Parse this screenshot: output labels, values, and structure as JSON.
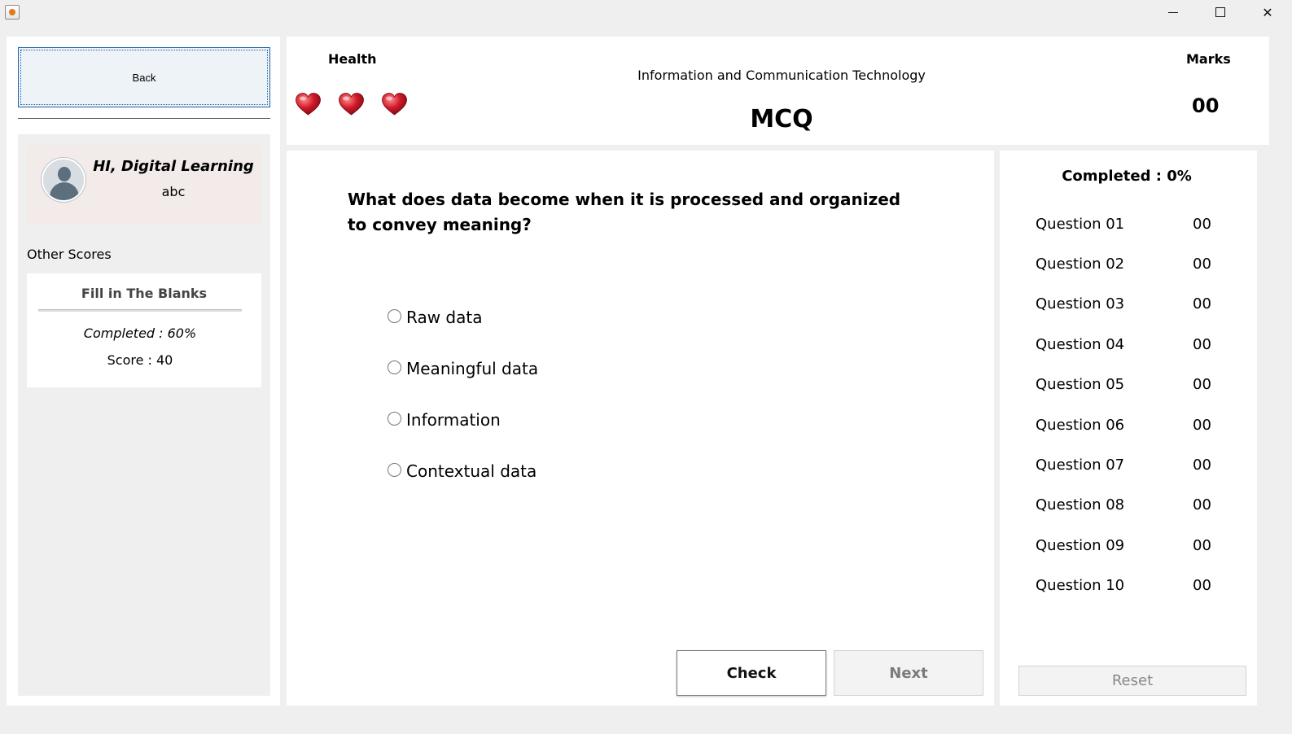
{
  "window": {
    "minimize_glyph": "",
    "maximize_glyph": "",
    "close_glyph": "✕"
  },
  "sidebar": {
    "back_label": "Back",
    "profile": {
      "greeting": "HI, Digital Learning",
      "username": "abc"
    },
    "other_scores_label": "Other Scores",
    "score_card": {
      "title": "Fill in The Blanks",
      "completed": "Completed : 60%",
      "score": "Score : 40"
    }
  },
  "header": {
    "health_label": "Health",
    "hearts_count": 3,
    "subject": "Information and Communication Technology",
    "mode": "MCQ",
    "marks_label": "Marks",
    "marks_value": "00",
    "heart_color": "#c8102e"
  },
  "question": {
    "text": "What does data become when it is processed and organized to convey meaning?",
    "options": [
      "Raw data",
      "Meaningful data",
      "Information",
      "Contextual data"
    ],
    "check_label": "Check",
    "next_label": "Next"
  },
  "progress": {
    "completed_title": "Completed : 0%",
    "rows": [
      {
        "name": "Question 01",
        "score": "00"
      },
      {
        "name": "Question 02",
        "score": "00"
      },
      {
        "name": "Question 03",
        "score": "00"
      },
      {
        "name": "Question 04",
        "score": "00"
      },
      {
        "name": "Question 05",
        "score": "00"
      },
      {
        "name": "Question 06",
        "score": "00"
      },
      {
        "name": "Question 07",
        "score": "00"
      },
      {
        "name": "Question 08",
        "score": "00"
      },
      {
        "name": "Question 09",
        "score": "00"
      },
      {
        "name": "Question 10",
        "score": "00"
      }
    ],
    "reset_label": "Reset"
  }
}
